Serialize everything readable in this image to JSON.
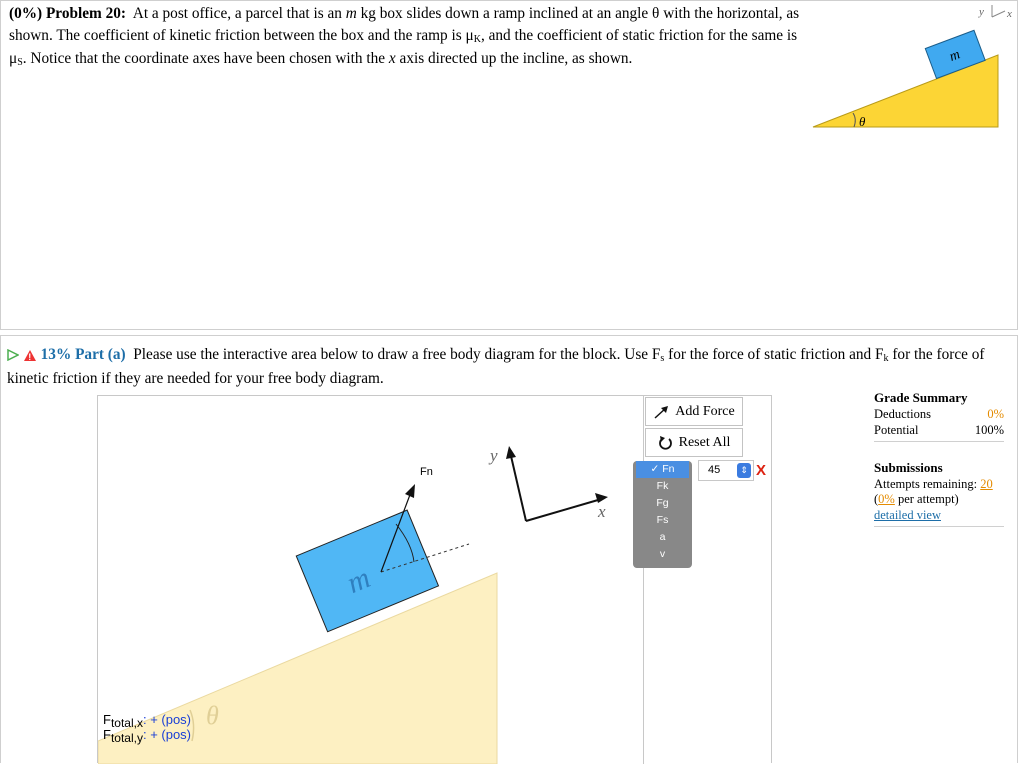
{
  "problem": {
    "label": "(0%) Problem 20:",
    "text_1": "At a post office, a parcel that is an",
    "m": "m",
    "text_2": "kg box slides down a ramp inclined at an angle θ with the horizontal, as shown. The coefficient of kinetic friction between the box and the ramp is μ",
    "mu_k_sub": "K",
    "text_3": ", and the coefficient of static friction for the same is μ",
    "mu_s_sub": "S",
    "text_4": ". Notice that the coordinate axes have been chosen with the",
    "x": "x",
    "text_5": "axis directed up the incline, as shown."
  },
  "figure": {
    "axis_y": "y",
    "axis_x": "x",
    "box_label": "m",
    "angle_label": "θ",
    "ramp_color": "#fcd535",
    "box_color": "#40a9f0"
  },
  "part_a": {
    "percent": "13%",
    "part_label": "Part (a)",
    "text_1": "Please use the interactive area below to draw a free body diagram for the block. Use F",
    "fs_sub": "s",
    "text_2": "for the force of static friction and F",
    "fk_sub": "k",
    "text_3": "for the force of kinetic friction if they are needed for your free body diagram."
  },
  "fbd": {
    "force_label": "Fn",
    "box_label": "m",
    "angle_label": "θ",
    "axis_y": "y",
    "axis_x": "x",
    "ramp_color": "#fdf0c2",
    "box_color": "#50b7f5",
    "add_force": "Add Force",
    "reset_all": "Reset All",
    "dropdown_options": [
      "Fn",
      "Fk",
      "Fg",
      "Fs",
      "a",
      "v"
    ],
    "selected_check": "✓",
    "angle_value": "45",
    "spin_glyph": "⇕",
    "delete_glyph": "X",
    "ftotal_x_F": "F",
    "ftotal_x_sub": "total,x",
    "ftotal_x_val": ": + (pos)",
    "ftotal_y_F": "F",
    "ftotal_y_sub": "total,y",
    "ftotal_y_val": ": + (pos)"
  },
  "grade_summary": {
    "title": "Grade Summary",
    "deductions_label": "Deductions",
    "deductions_value": "0%",
    "potential_label": "Potential",
    "potential_value": "100%",
    "submissions_title": "Submissions",
    "attempts_label": "Attempts remaining:",
    "attempts_value": "20",
    "per_attempt_pct": "0%",
    "per_attempt_text": "per attempt)",
    "open_paren": "(",
    "detailed_view": "detailed view"
  }
}
